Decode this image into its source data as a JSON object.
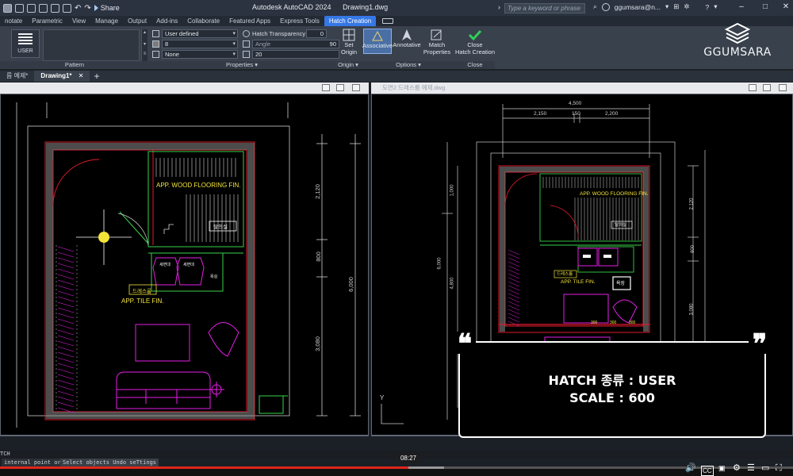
{
  "titlebar": {
    "share_label": "Share",
    "app_title": "Autodesk AutoCAD 2024",
    "file_title": "Drawing1.dwg",
    "search_placeholder": "Type a keyword or phrase",
    "user_name": "ggumsara@n...",
    "minimize": "‒",
    "maximize": "□",
    "close": "✕"
  },
  "ribbon_tabs": [
    "notate",
    "Parametric",
    "View",
    "Manage",
    "Output",
    "Add-ins",
    "Collaborate",
    "Featured Apps",
    "Express Tools",
    "Hatch Creation"
  ],
  "active_tab": "Hatch Creation",
  "ribbon": {
    "pattern_tile": "USER",
    "pattern_panel": "Pattern",
    "properties_panel": "Properties ▾",
    "hatch_type": "User defined",
    "color_value": "8",
    "bg_value": "None",
    "transparency_label": "Hatch Transparency",
    "transparency_value": "0",
    "angle_label": "Angle",
    "angle_value": "90",
    "spacing_value": "20",
    "set_origin": "Set\nOrigin",
    "origin_panel": "Origin ▾",
    "associative": "Associative",
    "annotative": "Annotative",
    "match_properties": "Match\nProperties",
    "options_panel": "Options ▾",
    "close_hatch": "Close\nHatch Creation",
    "close_panel": "Close"
  },
  "logo": {
    "name": "GGUMSARA"
  },
  "file_tabs": {
    "tab1": "름 예제*",
    "tab2": "Drawing1*",
    "close": "✕",
    "add": "+"
  },
  "left_viewport": {
    "labels": {
      "wood": "APP. WOOD FLOORING FIN.",
      "room_tag": "탈의실",
      "dress_tag": "드레스룸",
      "tile": "APP. TILE FIN.",
      "sink1": "세면대",
      "sink2": "세면대",
      "small": "욕실"
    },
    "dims": {
      "d1": "2,120",
      "d2": "800",
      "d3": "3,080",
      "total": "6,000"
    }
  },
  "right_viewport": {
    "title": "도면2 드레스룸 예제.dwg",
    "labels": {
      "wood": "APP.  WOOD FLOORING FIN.",
      "room_tag": "탈의실",
      "dress_tag": "드레스룸",
      "tile": "APP. TILE FIN.",
      "bath": "욕장"
    },
    "dims": {
      "top": "4,500",
      "t1": "2,150",
      "t2": "150",
      "t3": "2,200",
      "l1": "1,000",
      "l2": "6,000",
      "l3": "4,800",
      "r1": "2,120",
      "r2": "800",
      "r3": "3,080",
      "b1": "300",
      "b2": "300",
      "b3": "300"
    },
    "axis_y": "Y"
  },
  "overlay": {
    "line1": "HATCH 종류 : USER",
    "line2": "SCALE : 600",
    "quote_open": "❝",
    "quote_close": "❞"
  },
  "command": {
    "label": "TCH",
    "prompt": "internal point or",
    "hint": "Select objects Undo seTtings"
  },
  "player": {
    "timecode": "08:27",
    "progress": 0.515,
    "buffered": 0.56
  },
  "colors": {
    "accent": "#3577e5",
    "wall_red": "#e21b2c",
    "magenta": "#e61ee6",
    "dim_white": "#cfcfcf",
    "label_yellow": "#f3e43a",
    "progress_red": "#e0261b"
  }
}
